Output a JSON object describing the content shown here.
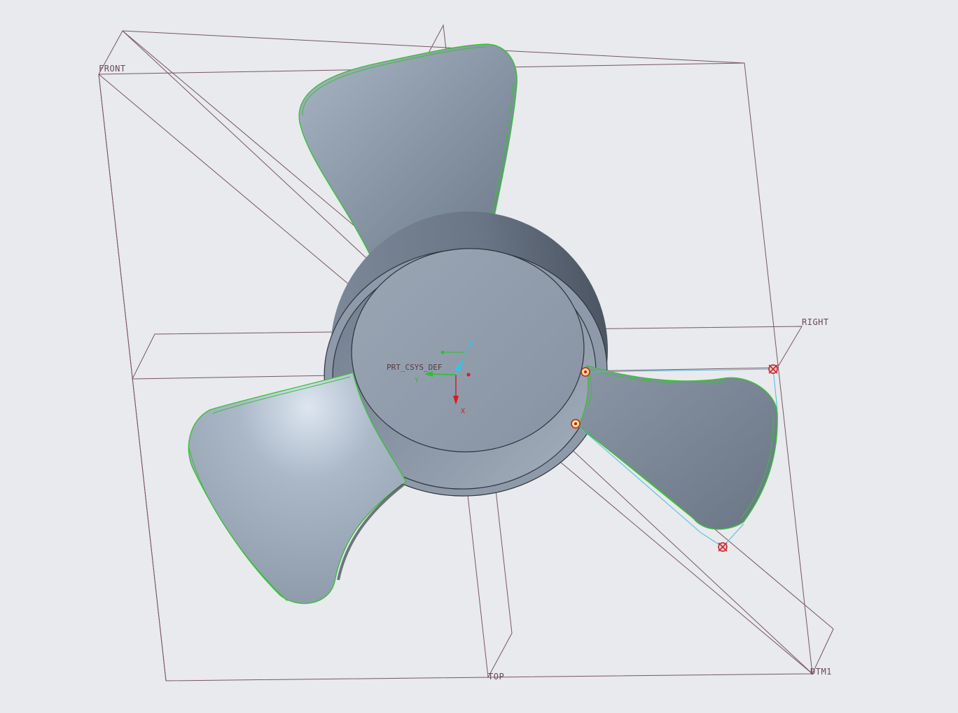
{
  "scene": {
    "datum_planes": [
      {
        "id": "front",
        "label": "FRONT"
      },
      {
        "id": "right",
        "label": "RIGHT"
      },
      {
        "id": "top",
        "label": "TOP"
      },
      {
        "id": "dtm1",
        "label": "DTM1"
      }
    ],
    "csys": {
      "label": "PRT_CSYS_DEF",
      "axis_x": "X",
      "axis_y": "Y"
    },
    "colors": {
      "background": "#e8eaed",
      "datum_plane_edge": "#7a5560",
      "model_edge_highlight": "#3bbf3b",
      "body_shade": "#8a97a6",
      "control_point": "#c0202a",
      "spline_curve": "#4fb8e0"
    },
    "model": {
      "name": "propeller",
      "blade_count": 3
    }
  }
}
